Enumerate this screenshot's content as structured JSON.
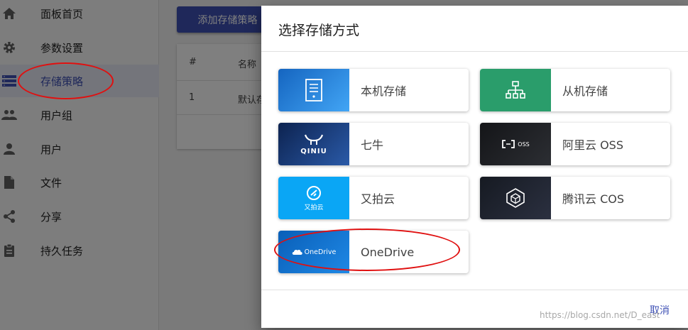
{
  "sidebar": {
    "items": [
      {
        "label": "面板首页",
        "icon": "home-icon"
      },
      {
        "label": "参数设置",
        "icon": "gear-icon"
      },
      {
        "label": "存储策略",
        "icon": "storage-icon",
        "active": true
      },
      {
        "label": "用户组",
        "icon": "group-icon"
      },
      {
        "label": "用户",
        "icon": "user-icon"
      },
      {
        "label": "文件",
        "icon": "file-icon"
      },
      {
        "label": "分享",
        "icon": "share-icon"
      },
      {
        "label": "持久任务",
        "icon": "task-icon"
      }
    ]
  },
  "main": {
    "add_button": "添加存储策略",
    "table": {
      "headers": [
        "#",
        "名称"
      ],
      "rows": [
        [
          "1",
          "默认存"
        ]
      ]
    }
  },
  "dialog": {
    "title": "选择存储方式",
    "options": [
      {
        "label": "本机存储",
        "icon": "server-icon",
        "color": "#1e7fd8"
      },
      {
        "label": "从机存储",
        "icon": "network-icon",
        "color": "#2a9d6b"
      },
      {
        "label": "七牛",
        "icon": "qiniu-logo",
        "logo_text": "QINIU",
        "color": "#1a3f7a"
      },
      {
        "label": "阿里云 OSS",
        "icon": "oss-logo",
        "logo_text": "OSS",
        "color": "#1c1d20"
      },
      {
        "label": "又拍云",
        "icon": "upyun-logo",
        "logo_text": "又拍云",
        "color": "#0aa6f5"
      },
      {
        "label": "腾讯云 COS",
        "icon": "cos-logo",
        "color": "#20242e"
      },
      {
        "label": "OneDrive",
        "icon": "onedrive-logo",
        "logo_text": "OneDrive",
        "color": "#0a6ed1"
      }
    ],
    "cancel": "取消"
  },
  "watermark": "https://blog.csdn.net/D_east"
}
